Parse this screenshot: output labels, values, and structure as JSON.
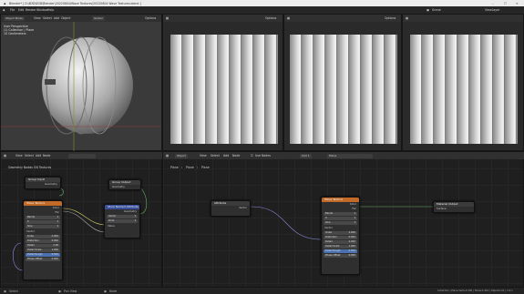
{
  "title_bar": {
    "text": "Blender* [ D:\\B3D\\B3D\\Blender\\20220804\\Wave Textures\\20220804 Wave Textures.blend ]",
    "win_buttons": [
      "–",
      "☐",
      "✕"
    ]
  },
  "menu": {
    "items": [
      "File",
      "Edit",
      "Render",
      "Window",
      "Help"
    ],
    "tabs": [
      "Layout",
      "Modeling",
      "Sculpting",
      "UV Editing",
      "Texture Paint",
      "Shading",
      "Animation",
      "Rendering",
      "Compositing",
      "Geometry Nodes",
      "Scripting"
    ],
    "active_tab": "Layout",
    "scene": "Scene",
    "view_layer": "ViewLayer"
  },
  "viewport1": {
    "mode": "Object Mode",
    "menus": [
      "View",
      "Select",
      "Add",
      "Object"
    ],
    "transform": "Global",
    "options": "Options",
    "info": [
      "User Perspective",
      "(1) Collection | Plane",
      "10 Centimeters"
    ]
  },
  "viewport2": {
    "options": "Options"
  },
  "viewport3": {
    "options": "Options"
  },
  "node_left": {
    "header": [
      "View",
      "Select",
      "Add",
      "Node"
    ],
    "breadcrumb": [
      "Geometry Nodes",
      "GN Textures"
    ],
    "group_input": {
      "title": "Group Input",
      "out": "Geometry"
    },
    "wave": {
      "title": "Wave Texture",
      "outs": [
        "Color",
        "Fac"
      ],
      "wave_type": "Bands",
      "direction": "X",
      "profile": "Sine",
      "vector": "Vector",
      "fields": [
        [
          "Scale",
          "2.000"
        ],
        [
          "Distortion",
          "0.000"
        ],
        [
          "Detail",
          "2.00"
        ],
        [
          "Detail Scale",
          "1.000"
        ],
        [
          "Detail Rough",
          "0.500"
        ],
        [
          "Phase Offset",
          "0.000"
        ]
      ]
    },
    "store": {
      "title": "Store Named Attribute",
      "type": "Vector",
      "domain": "Point",
      "name": "Geometry",
      "value": "Value"
    },
    "group_output": {
      "title": "Group Output",
      "in": "Geometry"
    }
  },
  "node_right": {
    "header": [
      "Object",
      "View",
      "Select",
      "Add",
      "Node"
    ],
    "use_nodes": "Use Nodes",
    "slot": "Slot 1",
    "material": "Plane",
    "breadcrumb": [
      "Plane",
      "Plane",
      "Plane"
    ],
    "attr": {
      "title": "Attribute",
      "out": "Vector"
    },
    "wave": {
      "title": "Wave Texture",
      "outs": [
        "Color",
        "Fac"
      ],
      "wave_type": "Bands",
      "direction": "X",
      "profile": "Sine",
      "vector": "Vector",
      "fields": [
        [
          "Scale",
          "2.000"
        ],
        [
          "Distortion",
          "0.000"
        ],
        [
          "Detail",
          "2.000"
        ],
        [
          "Detail Scale",
          "1.000"
        ],
        [
          "Detail Rough",
          "0.500"
        ],
        [
          "Phase Offset",
          "0.000"
        ]
      ]
    },
    "output": {
      "title": "Material Output",
      "in": "Surface"
    }
  },
  "status": {
    "left": [
      "Select",
      "Pan View",
      "Node"
    ],
    "right": "Collection | Plane  Verts:2,500 | Faces:2,401 | Objects:1/1 | 3.2.1"
  }
}
